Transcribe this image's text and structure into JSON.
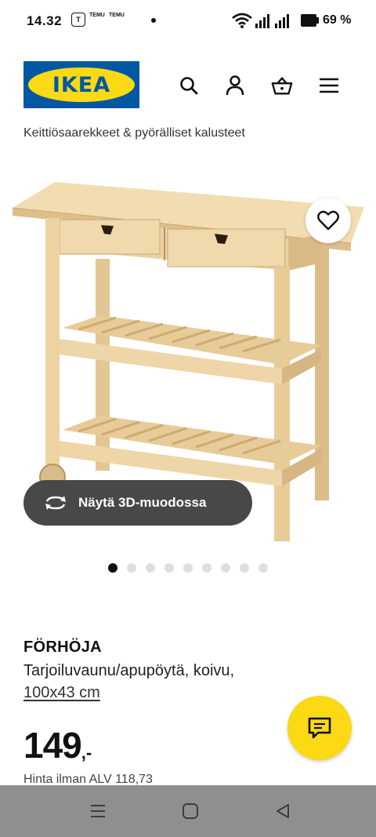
{
  "status_bar": {
    "time": "14.32",
    "notification_label": "TEMU",
    "battery": "69 %"
  },
  "header": {
    "logo_text": "IKEA",
    "icons": [
      "search-icon",
      "user-icon",
      "basket-icon",
      "menu-icon"
    ]
  },
  "breadcrumb": "Keittiösaarekkeet & pyörälliset kalusteet",
  "gallery": {
    "view_3d_label": "Näytä 3D-muodossa",
    "dot_count": 9,
    "active_dot": 0
  },
  "product": {
    "name": "FÖRHÖJA",
    "description": "Tarjoiluvaunu/apupöytä, koivu,",
    "size": "100x43 cm",
    "price": "149",
    "price_suffix": ",-",
    "vat_price": "Hinta ilman ALV 118,73"
  },
  "colors": {
    "brand_blue": "#0058a3",
    "brand_yellow": "#fbd914",
    "dark_button": "#484848",
    "nav_bar": "#8f8f8f"
  }
}
